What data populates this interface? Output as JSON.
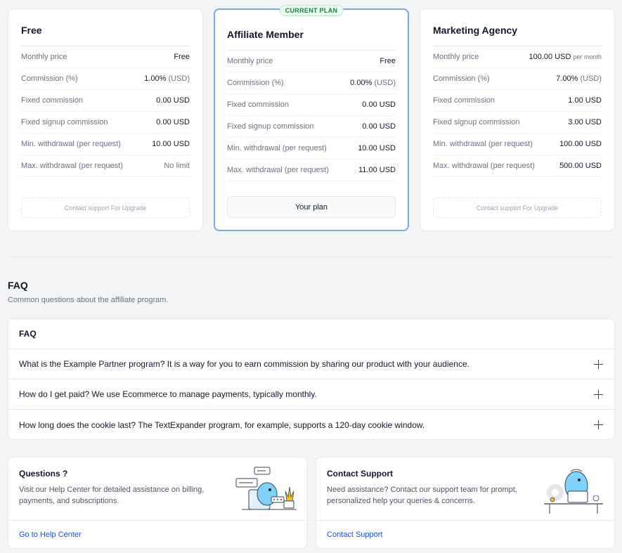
{
  "plans": [
    {
      "title": "Free",
      "badge": "",
      "rows": [
        {
          "label": "Monthly price",
          "value": "Free",
          "unit": "",
          "suffix": ""
        },
        {
          "label": "Commission (%)",
          "value": "1.00%",
          "unit": "(USD)",
          "suffix": ""
        },
        {
          "label": "Fixed commission",
          "value": "0.00 USD",
          "unit": "",
          "suffix": ""
        },
        {
          "label": "Fixed signup commission",
          "value": "0.00 USD",
          "unit": "",
          "suffix": ""
        },
        {
          "label": "Min. withdrawal (per request)",
          "value": "10.00 USD",
          "unit": "",
          "suffix": ""
        },
        {
          "label": "Max. withdrawal (per request)",
          "value": "No limit",
          "unit": "",
          "suffix": ""
        }
      ],
      "action": "Contact support For Upgrade"
    },
    {
      "title": "Affiliate Member",
      "badge": "CURRENT PLAN",
      "rows": [
        {
          "label": "Monthly price",
          "value": "Free",
          "unit": "",
          "suffix": ""
        },
        {
          "label": "Commission (%)",
          "value": "0.00%",
          "unit": "(USD)",
          "suffix": ""
        },
        {
          "label": "Fixed commission",
          "value": "0.00 USD",
          "unit": "",
          "suffix": ""
        },
        {
          "label": "Fixed signup commission",
          "value": "0.00 USD",
          "unit": "",
          "suffix": ""
        },
        {
          "label": "Min. withdrawal (per request)",
          "value": "10.00 USD",
          "unit": "",
          "suffix": ""
        },
        {
          "label": "Max. withdrawal (per request)",
          "value": "11.00 USD",
          "unit": "",
          "suffix": ""
        }
      ],
      "action": "Your plan"
    },
    {
      "title": "Marketing Agency",
      "badge": "",
      "rows": [
        {
          "label": "Monthly price",
          "value": "100.00 USD",
          "unit": "",
          "suffix": "per month"
        },
        {
          "label": "Commission (%)",
          "value": "7.00%",
          "unit": "(USD)",
          "suffix": ""
        },
        {
          "label": "Fixed commission",
          "value": "1.00 USD",
          "unit": "",
          "suffix": ""
        },
        {
          "label": "Fixed signup commission",
          "value": "3.00 USD",
          "unit": "",
          "suffix": ""
        },
        {
          "label": "Min. withdrawal (per request)",
          "value": "100.00 USD",
          "unit": "",
          "suffix": ""
        },
        {
          "label": "Max. withdrawal (per request)",
          "value": "500.00 USD",
          "unit": "",
          "suffix": ""
        }
      ],
      "action": "Contact support For Upgrade"
    }
  ],
  "faq": {
    "heading": "FAQ",
    "subtitle": "Common questions about the affiliate program.",
    "box_title": "FAQ",
    "items": [
      "What is the Example Partner program? It is a way for you to earn commission by sharing our product with your audience.",
      "How do I get paid? We use Ecommerce to manage payments, typically monthly.",
      "How long does the cookie last? The TextExpander program, for example, supports a 120-day cookie window."
    ]
  },
  "cards": [
    {
      "title": "Questions ?",
      "description": "Visit our Help Center for detailed assistance on billing, payments, and subscriptions.",
      "link": "Go to Help Center",
      "illustration": "help-center-illustration"
    },
    {
      "title": "Contact Support",
      "description": "Need assistance? Contact our support team for prompt, personalized help your queries & concerns.",
      "link": "Contact Support",
      "illustration": "support-illustration"
    }
  ],
  "colors": {
    "accent": "#1d4ed8",
    "current_plan_border": "#7aa7e8",
    "badge_green": "#15803d"
  }
}
